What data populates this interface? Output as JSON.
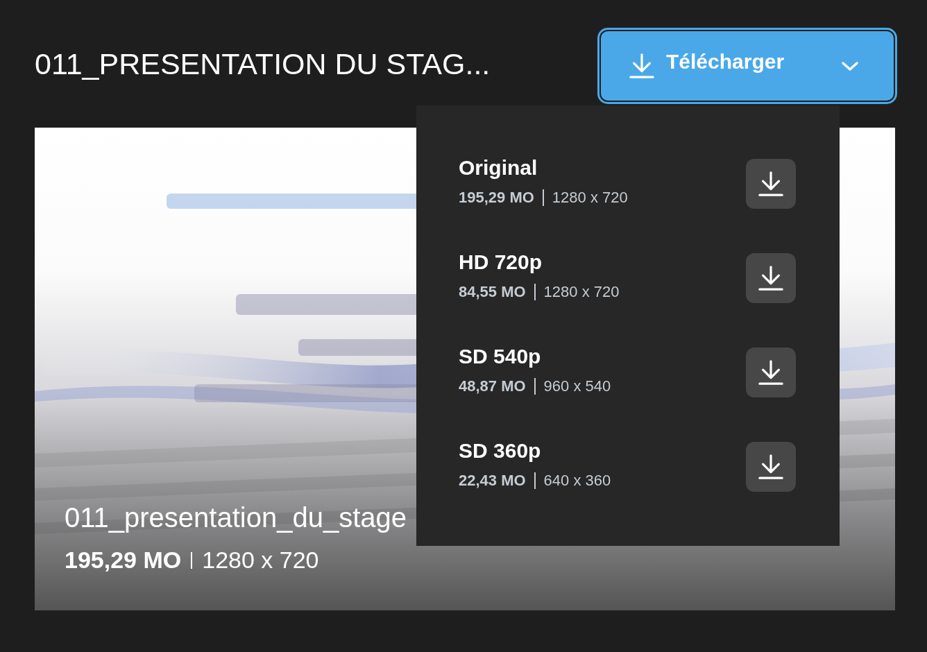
{
  "title": "011_PRESENTATION DU STAG...",
  "download_button": {
    "label": "Télécharger",
    "expanded": true
  },
  "video": {
    "kind": "picture",
    "caption": "011_presentation_du_stage",
    "size": "195,29 MO",
    "resolution": "1280 x 720"
  },
  "download_menu": {
    "options": [
      {
        "name": "Original",
        "size": "195,29 MO",
        "resolution": "1280 x 720"
      },
      {
        "name": "HD 720p",
        "size": "84,55 MO",
        "resolution": "1280 x 720"
      },
      {
        "name": "SD 540p",
        "size": "48,87 MO",
        "resolution": "960 x 540"
      },
      {
        "name": "SD 360p",
        "size": "22,43 MO",
        "resolution": "640 x 360"
      }
    ]
  }
}
